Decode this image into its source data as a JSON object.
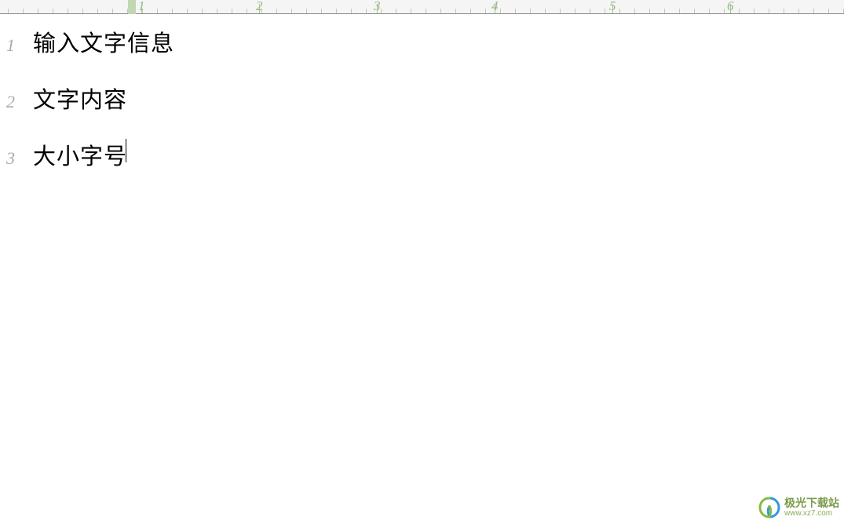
{
  "ruler": {
    "numbers": [
      "1",
      "2",
      "3",
      "4",
      "5",
      "6"
    ]
  },
  "document": {
    "lines": [
      {
        "number": "1",
        "text": "输入文字信息"
      },
      {
        "number": "2",
        "text": "文字内容"
      },
      {
        "number": "3",
        "text": "大小字号"
      }
    ]
  },
  "watermark": {
    "title": "极光下载站",
    "url": "www.xz7.com"
  }
}
